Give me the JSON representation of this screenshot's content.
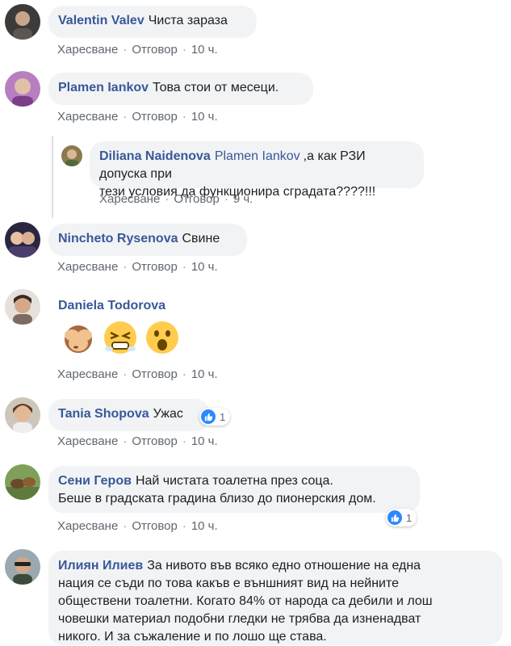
{
  "actions": {
    "like": "Харесване",
    "reply": "Отговор",
    "dot": "·"
  },
  "comments": [
    {
      "author": "Valentin Valev",
      "text": "Чиста зараза",
      "time": "10 ч."
    },
    {
      "author": "Plamen Iankov",
      "text": "Това стои от месеци.",
      "time": "10 ч."
    },
    {
      "author": "Diliana Naidenova",
      "mention": "Plamen Iankov",
      "text_line1": ",а как РЗИ допуска при",
      "text_line2": "тези условия да функционира сградата????!!!",
      "time": "9 ч."
    },
    {
      "author": "Nincheto Rysenova",
      "text": "Свине",
      "time": "10 ч."
    },
    {
      "author": "Daniela Todorova",
      "time": "10 ч.",
      "emojis": [
        "see-no-evil-monkey",
        "persevering-face",
        "astonished-face"
      ]
    },
    {
      "author": "Tania Shopova",
      "text": "Ужас",
      "time": "10 ч.",
      "reaction_count": "1"
    },
    {
      "author": "Сени Геров",
      "text_line1": "Най чистата тоалетна през соца.",
      "text_line2": "Беше в градската градина близо до пионерския дом.",
      "time": "10 ч.",
      "reaction_count": "1"
    },
    {
      "author": "Илиян Илиев",
      "text_line1": "За нивото във всяко едно отношение на една",
      "text_line2": "нация се съди по това какъв е външният вид на нейните",
      "text_line3": "обществени тоалетни. Когато 84% от народа са дебили и лош",
      "text_line4": "човешки материал подобни гледки не трябва да изненадват",
      "text_line5": "никого. И за съжаление и по лошо ще става."
    }
  ],
  "colors": {
    "bubble": "#f2f3f5",
    "author": "#385898",
    "meta": "#606770",
    "like_blue": "#2d88ff"
  }
}
